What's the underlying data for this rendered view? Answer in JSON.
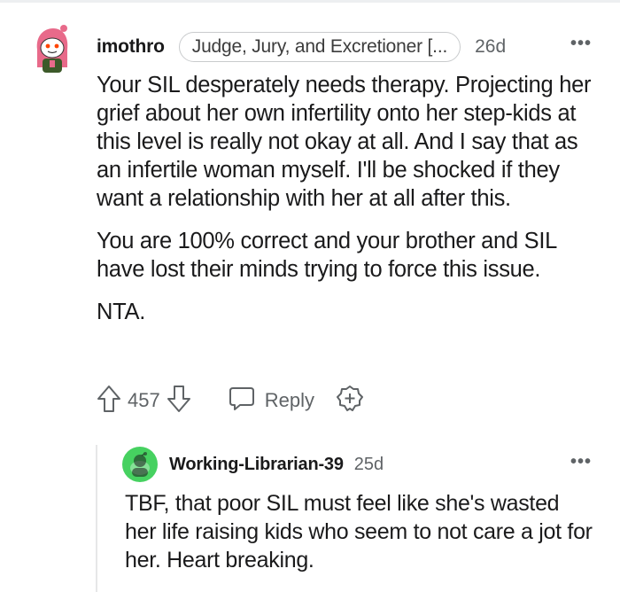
{
  "comment": {
    "username": "imothro",
    "flair": "Judge, Jury, and Excretioner [...",
    "timestamp": "26d",
    "more_icon": "more-options-icon",
    "paragraphs": [
      "Your SIL desperately needs therapy. Projecting her grief about her own infertility onto her step-kids at this level is really not okay at all. And I say that as an infertile woman myself. I'll be shocked if they want a relationship with her at all after this.",
      "You are 100% correct and your brother and SIL have lost their minds trying to force this issue.",
      "NTA."
    ],
    "score": "457",
    "reply_label": "Reply",
    "icons": [
      "upvote-icon",
      "downvote-icon",
      "reply-icon",
      "award-icon"
    ]
  },
  "reply": {
    "username": "Working-Librarian-39",
    "timestamp": "25d",
    "text": "TBF, that poor SIL must feel like she's wasted her life raising kids who seem to not care a jot for her. Heart breaking."
  },
  "colors": {
    "text": "#1a1a1b",
    "meta": "#5f6366",
    "avatar_pink": "#e86a8a",
    "avatar_green": "#46d160"
  }
}
